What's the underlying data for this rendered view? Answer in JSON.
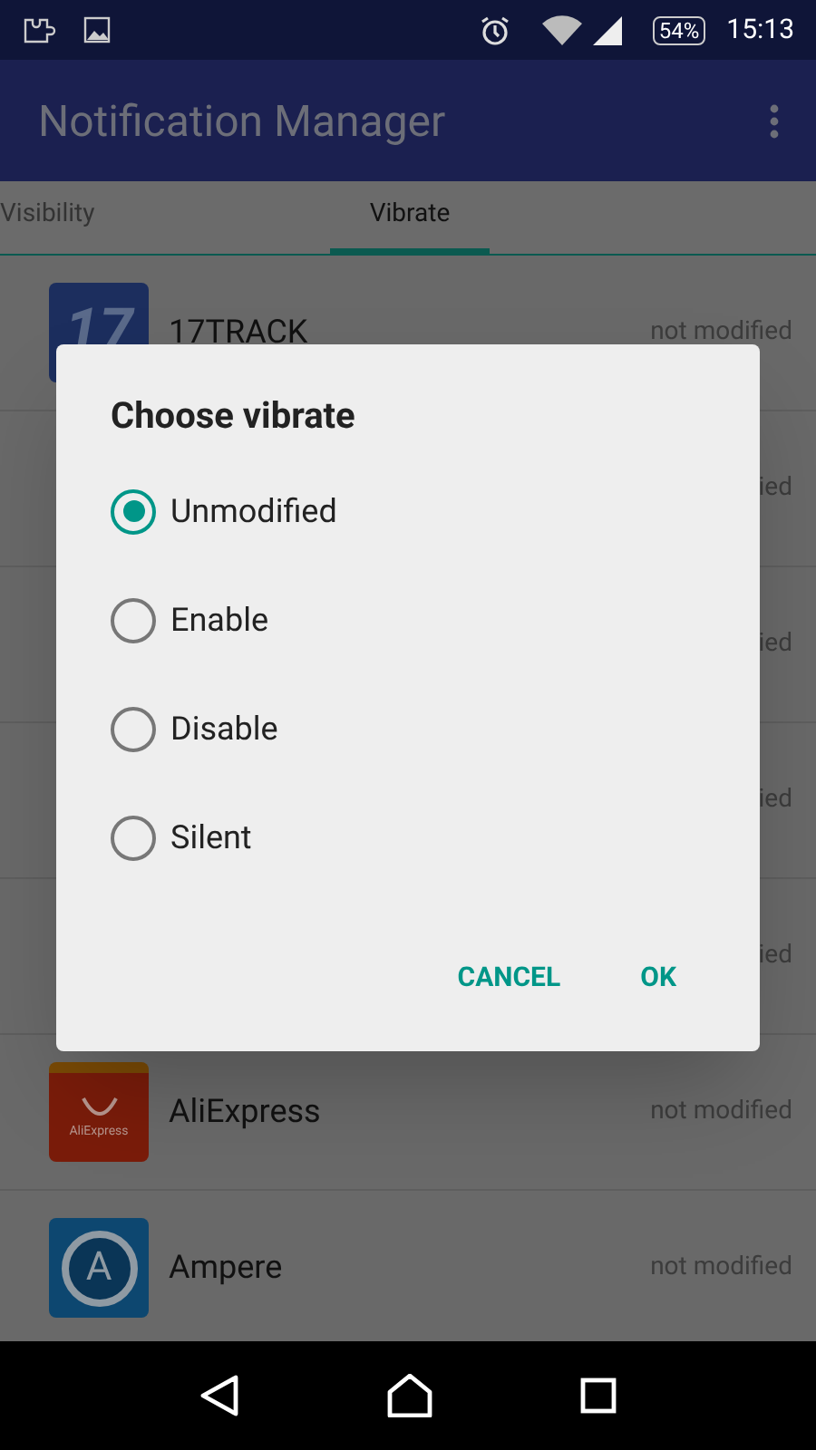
{
  "status_bar": {
    "battery": "54%",
    "time": "15:13"
  },
  "app_bar": {
    "title": "Notification Manager"
  },
  "tabs": [
    {
      "label": "Visibility",
      "selected": false
    },
    {
      "label": "Vibrate",
      "selected": true
    }
  ],
  "apps": [
    {
      "kind": "track",
      "name": "17TRACK",
      "logo_text": "17",
      "status": "not modified"
    },
    {
      "kind": "hidden",
      "status": "ied"
    },
    {
      "kind": "hidden",
      "status": "ied"
    },
    {
      "kind": "hidden",
      "status": "ied"
    },
    {
      "kind": "hidden",
      "status": "ied"
    },
    {
      "kind": "ali",
      "name": "AliExpress",
      "logo_text": "AliExpress",
      "status": "not modified"
    },
    {
      "kind": "ampere",
      "name": "Ampere",
      "logo_text": "A",
      "status": "not modified"
    }
  ],
  "dialog": {
    "title": "Choose vibrate",
    "options": [
      {
        "label": "Unmodified",
        "selected": true
      },
      {
        "label": "Enable",
        "selected": false
      },
      {
        "label": "Disable",
        "selected": false
      },
      {
        "label": "Silent",
        "selected": false
      }
    ],
    "buttons": [
      "CANCEL",
      "OK"
    ]
  }
}
